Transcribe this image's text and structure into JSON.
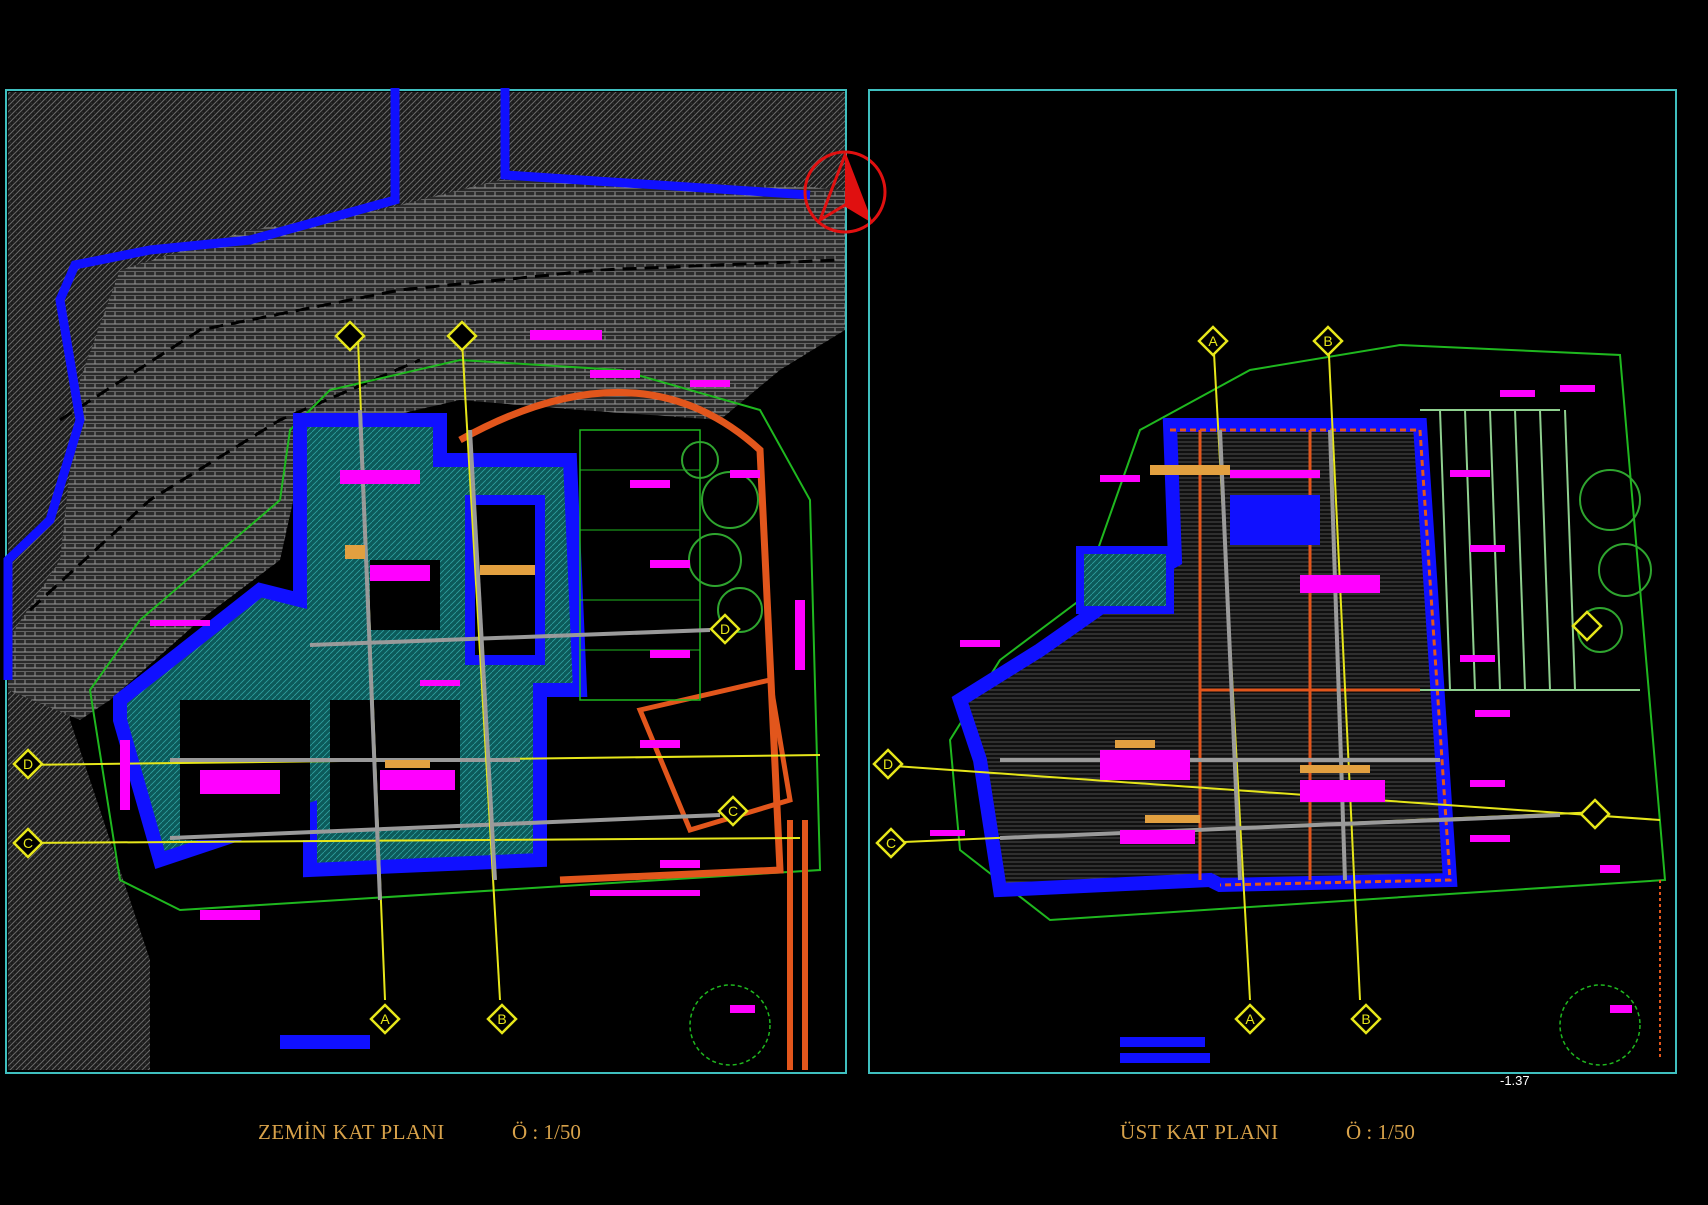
{
  "sheets": [
    {
      "title": "ZEMİN KAT PLANI",
      "scale": "Ö : 1/50",
      "grid_labels": [
        "A",
        "B",
        "C",
        "D"
      ]
    },
    {
      "title": "ÜST KAT PLANI",
      "scale": "Ö : 1/50",
      "grid_labels": [
        "A",
        "B",
        "C",
        "D"
      ],
      "level_mark": "-1.37"
    }
  ],
  "colors": {
    "background": "#000000",
    "frame": "#3fbfbf",
    "walls": "#1010ff",
    "terrace": "#1a8a8a",
    "grid_axis": "#e6e61a",
    "grid_line": "#9a9a9a",
    "text_labels": "#ff00ff",
    "title_text": "#d8a24a",
    "pergola": "#e2561c",
    "vegetation": "#2fa52f",
    "north_arrow": "#e01010"
  },
  "icons": [
    "north-arrow-icon",
    "grid-bubble-icon",
    "tree-icon",
    "level-marker-icon"
  ]
}
